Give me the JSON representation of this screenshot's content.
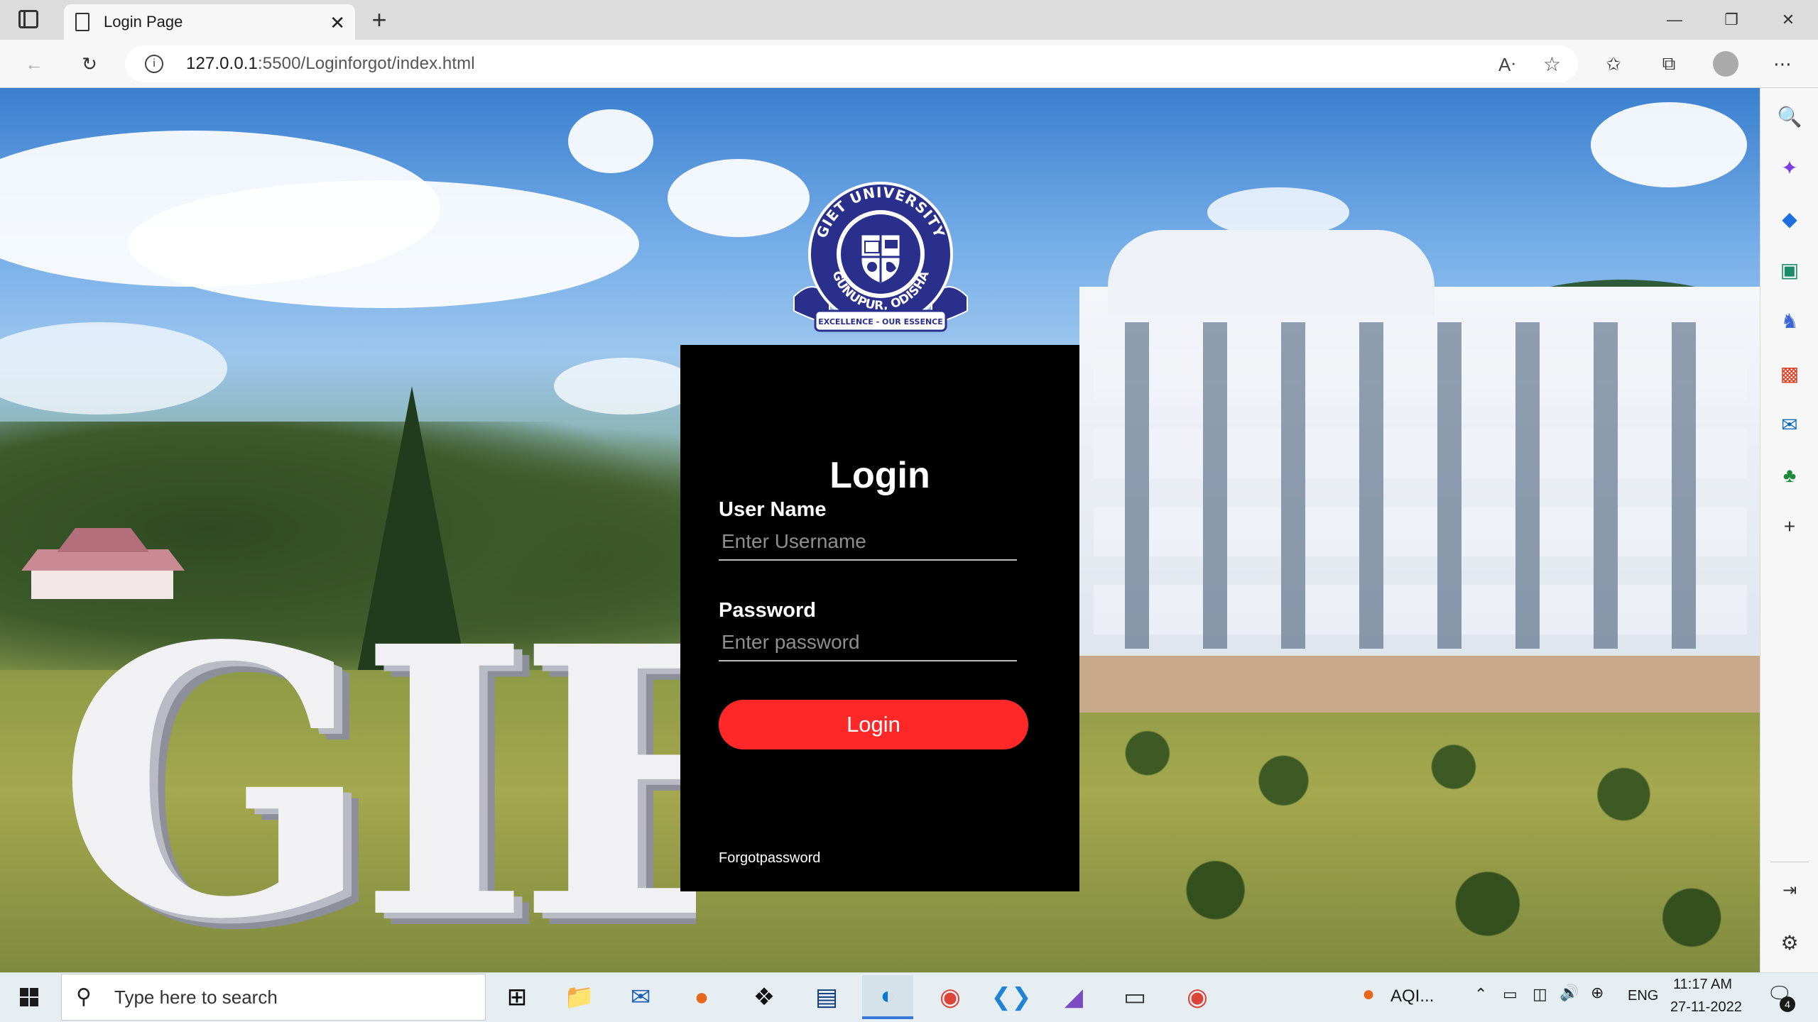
{
  "browser": {
    "tab_title": "Login Page",
    "url_host": "127.0.0.1",
    "url_path": ":5500/Loginforgot/index.html"
  },
  "login": {
    "heading": "Login",
    "username_label": "User Name",
    "username_placeholder": "Enter Username",
    "password_label": "Password",
    "password_placeholder": "Enter password",
    "button_label": "Login",
    "forgot_label": "Forgotpassword"
  },
  "logo": {
    "top_text": "GIET UNIVERSITY",
    "bottom_text": "GUNUPUR, ODISHA",
    "motto": "EXCELLENCE - OUR ESSENCE",
    "colors": {
      "navy": "#2b2f8c",
      "white": "#ffffff"
    }
  },
  "background": {
    "sign_text": "GIE"
  },
  "taskbar": {
    "search_placeholder": "Type here to search",
    "weather": "AQI...",
    "language": "ENG",
    "time": "11:17 AM",
    "date": "27-11-2022",
    "notification_count": "4"
  },
  "colors": {
    "button_red": "#ff2828",
    "card": "#000000",
    "edge_accent": "#3a78d8"
  }
}
